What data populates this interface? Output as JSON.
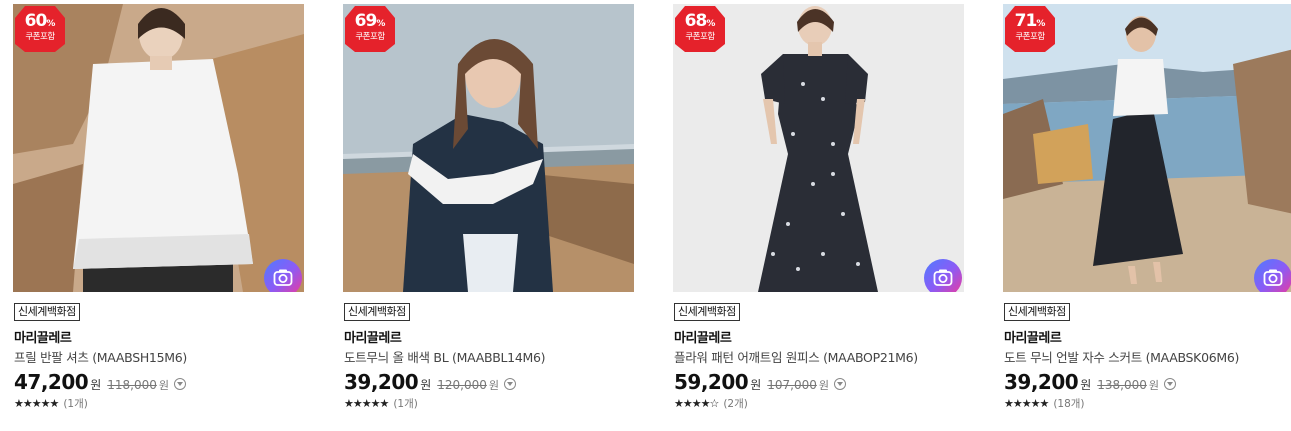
{
  "products": [
    {
      "discount": "60",
      "discount_unit": "%",
      "coupon_label": "쿠폰포함",
      "store": "신세계백화점",
      "brand": "마리끌레르",
      "name": "프릴 반팔 셔츠 (MAABSH15M6)",
      "price": "47,200",
      "price_unit": "원",
      "original_price": "118,000",
      "original_unit": "원",
      "stars": "★★★★★",
      "review_count": "(1개)",
      "has_camera": true
    },
    {
      "discount": "69",
      "discount_unit": "%",
      "coupon_label": "쿠폰포함",
      "store": "신세계백화점",
      "brand": "마리끌레르",
      "name": "도트무늬 올 배색 BL (MAABBL14M6)",
      "price": "39,200",
      "price_unit": "원",
      "original_price": "120,000",
      "original_unit": "원",
      "stars": "★★★★★",
      "review_count": "(1개)",
      "has_camera": false
    },
    {
      "discount": "68",
      "discount_unit": "%",
      "coupon_label": "쿠폰포함",
      "store": "신세계백화점",
      "brand": "마리끌레르",
      "name": "플라워 패턴 어깨트임 원피스 (MAABOP21M6)",
      "price": "59,200",
      "price_unit": "원",
      "original_price": "107,000",
      "original_unit": "원",
      "stars": "★★★★☆",
      "review_count": "(2개)",
      "has_camera": true
    },
    {
      "discount": "71",
      "discount_unit": "%",
      "coupon_label": "쿠폰포함",
      "store": "신세계백화점",
      "brand": "마리끌레르",
      "name": "도트 무늬 언발 자수 스커트 (MAABSK06M6)",
      "price": "39,200",
      "price_unit": "원",
      "original_price": "138,000",
      "original_unit": "원",
      "stars": "★★★★★",
      "review_count": "(18개)",
      "has_camera": true
    }
  ],
  "colors": {
    "badge_red": "#e5222b",
    "camera_gradient": [
      "#4f7bff",
      "#8a5cf6",
      "#f0379a"
    ]
  },
  "icons": {
    "camera": "camera-icon",
    "info": "chevron-down-circle-icon",
    "star": "star-icon"
  }
}
